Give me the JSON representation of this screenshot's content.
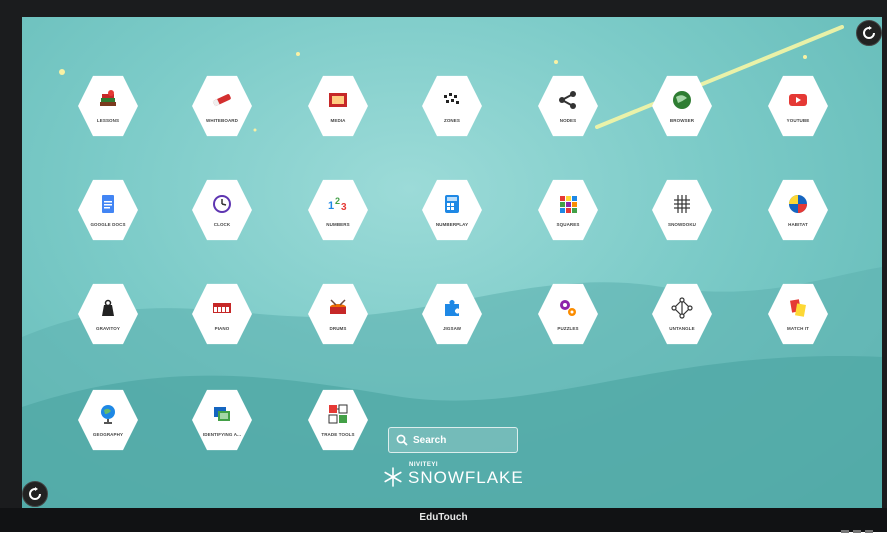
{
  "device": {
    "brand": "EduTouch"
  },
  "apps": [
    {
      "label": "LESSONS",
      "icon": "books-icon"
    },
    {
      "label": "WHITEBOARD",
      "icon": "marker-icon"
    },
    {
      "label": "MEDIA",
      "icon": "media-icon"
    },
    {
      "label": "ZONES",
      "icon": "zones-icon"
    },
    {
      "label": "NODES",
      "icon": "share-nodes-icon"
    },
    {
      "label": "BROWSER",
      "icon": "globe-icon"
    },
    {
      "label": "YOUTUBE",
      "icon": "youtube-icon"
    },
    {
      "label": "GOOGLE DOCS",
      "icon": "google-docs-icon"
    },
    {
      "label": "CLOCK",
      "icon": "clock-icon"
    },
    {
      "label": "NUMBERS",
      "icon": "numbers-icon"
    },
    {
      "label": "NUMBERPLAY",
      "icon": "calculator-icon"
    },
    {
      "label": "SQUARES",
      "icon": "squares-icon"
    },
    {
      "label": "SNOWDOKU",
      "icon": "grid-icon"
    },
    {
      "label": "HABITAT",
      "icon": "habitat-icon"
    },
    {
      "label": "GRAVITOY",
      "icon": "weight-icon"
    },
    {
      "label": "PIANO",
      "icon": "piano-icon"
    },
    {
      "label": "DRUMS",
      "icon": "drums-icon"
    },
    {
      "label": "JIGSAW",
      "icon": "puzzle-piece-icon"
    },
    {
      "label": "PUZZLES",
      "icon": "gears-icon"
    },
    {
      "label": "UNTANGLE",
      "icon": "untangle-icon"
    },
    {
      "label": "MATCH IT",
      "icon": "cards-icon"
    },
    {
      "label": "GEOGRAPHY",
      "icon": "globe-stand-icon"
    },
    {
      "label": "IDENTIFYING A...",
      "icon": "pictures-icon"
    },
    {
      "label": "TRADE TOOLS",
      "icon": "tools-icon"
    }
  ],
  "search": {
    "label": "Search"
  },
  "logo": {
    "small": "NIVITEYI",
    "name": "SNOWFLAKE"
  },
  "colors": {
    "background": "#7ccbc8",
    "bezel": "#1b1c1e"
  }
}
